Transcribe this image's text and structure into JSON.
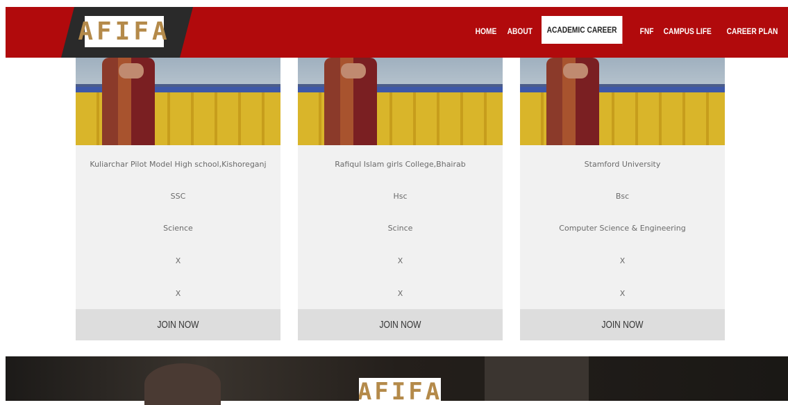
{
  "header": {
    "logo": "AFIFA",
    "nav": [
      "HOME",
      "ABOUT",
      "ACADEMIC CAREER",
      "FNF",
      "CAMPUS LIFE",
      "CAREER PLAN"
    ],
    "active_nav": "ACADEMIC CAREER"
  },
  "cards": [
    {
      "institution": "Kuliarchar Pilot Model High school,Kishoreganj",
      "degree": "SSC",
      "group": "Science",
      "field4": "X",
      "field5": "X",
      "button": "JOIN NOW"
    },
    {
      "institution": "Rafiqul Islam girls College,Bhairab",
      "degree": "Hsc",
      "group": "Scince",
      "field4": "X",
      "field5": "X",
      "button": "JOIN NOW"
    },
    {
      "institution": "Stamford University",
      "degree": "Bsc",
      "group": "Computer Science & Engineering",
      "field4": "X",
      "field5": "X",
      "button": "JOIN NOW"
    }
  ],
  "footer": {
    "logo": "AFIFA"
  },
  "colors": {
    "header_red": "#b10a0c",
    "logo_gold": "#b48a4a",
    "card_bg": "#f1f1f1",
    "button_bg": "#dddddd"
  }
}
